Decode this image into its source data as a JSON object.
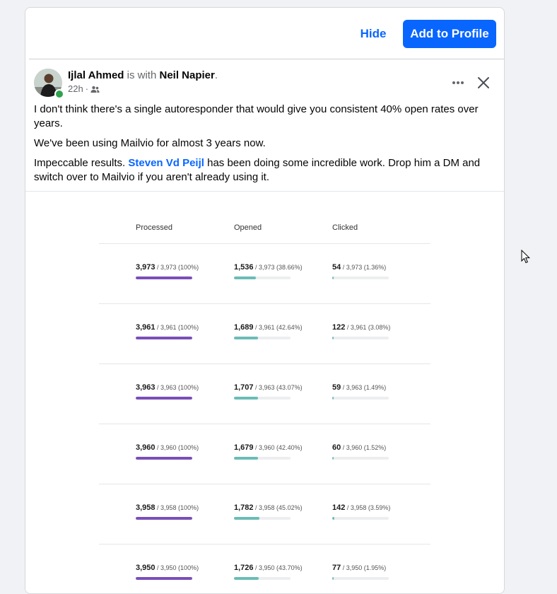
{
  "actions": {
    "hide_label": "Hide",
    "add_label": "Add to Profile"
  },
  "post": {
    "author": "Ijlal Ahmed",
    "with_text": " is with ",
    "tagged": "Neil Napier",
    "period": ".",
    "time": "22h",
    "separator": "·",
    "audience_icon": "friends-icon",
    "text_line1": "I don't think there's a single autoresponder that would give you consistent 40% open rates over years.",
    "text_line2": "We've been using Mailvio for almost 3 years now.",
    "text_line3_before": "Impeccable results. ",
    "text_line3_mention": "Steven Vd Peijl",
    "text_line3_after": " has been doing some incredible work. Drop him a DM and switch over to Mailvio if you aren't already using it."
  },
  "stats": {
    "headers": [
      "Processed",
      "Opened",
      "Clicked"
    ],
    "colors": {
      "processed": "#7a4fb8",
      "opened": "#6bbcb6",
      "clicked": "#6bbcb6"
    },
    "rows": [
      {
        "p_big": "3,973",
        "p_small": "/ 3,973 (100%)",
        "p_frac": 1.0,
        "o_big": "1,536",
        "o_small": "/ 3,973 (38.66%)",
        "o_frac": 0.3866,
        "c_big": "54",
        "c_small": "/ 3,973 (1.36%)",
        "c_frac": 0.0136
      },
      {
        "p_big": "3,961",
        "p_small": "/ 3,961 (100%)",
        "p_frac": 1.0,
        "o_big": "1,689",
        "o_small": "/ 3,961 (42.64%)",
        "o_frac": 0.4264,
        "c_big": "122",
        "c_small": "/ 3,961 (3.08%)",
        "c_frac": 0.0308
      },
      {
        "p_big": "3,963",
        "p_small": "/ 3,963 (100%)",
        "p_frac": 1.0,
        "o_big": "1,707",
        "o_small": "/ 3,963 (43.07%)",
        "o_frac": 0.4307,
        "c_big": "59",
        "c_small": "/ 3,963 (1.49%)",
        "c_frac": 0.0149
      },
      {
        "p_big": "3,960",
        "p_small": "/ 3,960 (100%)",
        "p_frac": 1.0,
        "o_big": "1,679",
        "o_small": "/ 3,960 (42.40%)",
        "o_frac": 0.424,
        "c_big": "60",
        "c_small": "/ 3,960 (1.52%)",
        "c_frac": 0.0152
      },
      {
        "p_big": "3,958",
        "p_small": "/ 3,958 (100%)",
        "p_frac": 1.0,
        "o_big": "1,782",
        "o_small": "/ 3,958 (45.02%)",
        "o_frac": 0.4502,
        "c_big": "142",
        "c_small": "/ 3,958 (3.59%)",
        "c_frac": 0.0359
      },
      {
        "p_big": "3,950",
        "p_small": "/ 3,950 (100%)",
        "p_frac": 1.0,
        "o_big": "1,726",
        "o_small": "/ 3,950 (43.70%)",
        "o_frac": 0.437,
        "c_big": "77",
        "c_small": "/ 3,950 (1.95%)",
        "c_frac": 0.0195
      }
    ]
  }
}
